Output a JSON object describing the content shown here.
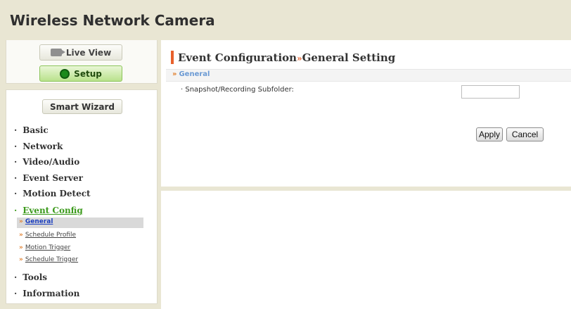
{
  "header": {
    "title": "Wireless Network Camera"
  },
  "top_buttons": {
    "live_view": "Live View",
    "setup": "Setup"
  },
  "wizard": {
    "label": "Smart Wizard"
  },
  "menu": {
    "items": [
      {
        "label": "Basic"
      },
      {
        "label": "Network"
      },
      {
        "label": "Video/Audio"
      },
      {
        "label": "Event Server"
      },
      {
        "label": "Motion Detect"
      },
      {
        "label": "Event Config"
      },
      {
        "label": "Tools"
      },
      {
        "label": "Information"
      }
    ],
    "bullet": "·",
    "sub_arrow": "»",
    "sub_items": [
      {
        "label": "General"
      },
      {
        "label": "Schedule Profile"
      },
      {
        "label": "Motion Trigger"
      },
      {
        "label": "Schedule Trigger"
      }
    ]
  },
  "page": {
    "title_part1": "Event Configuration",
    "title_sep": "»",
    "title_part2": "General Setting",
    "section_arrow": "»",
    "section": "General",
    "field_label": "· Snapshot/Recording Subfolder:",
    "field_value": "",
    "apply": "Apply",
    "cancel": "Cancel"
  },
  "colors": {
    "accent": "#e8602c",
    "active_menu": "#3c9a1c",
    "section": "#6b9ad4",
    "header_bg": "#e9e6d3"
  }
}
